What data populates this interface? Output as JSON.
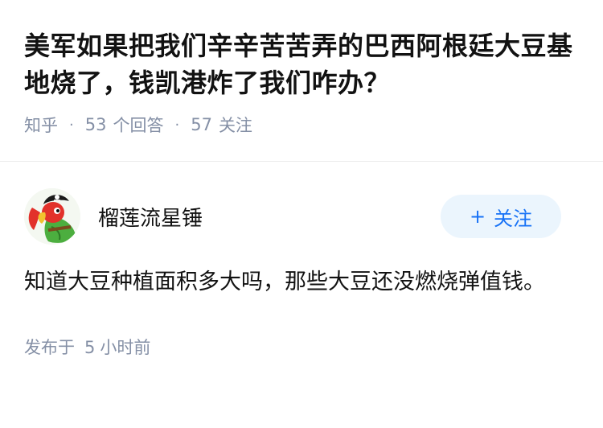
{
  "question": {
    "title": "美军如果把我们辛辛苦苦弄的巴西阿根廷大豆基地烧了，钱凯港炸了我们咋办？",
    "source": "知乎",
    "answer_count": "53",
    "answer_label": "个回答",
    "follower_count": "57",
    "follower_label": "关注"
  },
  "answer": {
    "author_name": "榴莲流星锤",
    "follow_label": "关注",
    "follow_icon": "plus-icon",
    "content": "知道大豆种植面积多大吗，那些大豆还没燃烧弹值钱。",
    "published_prefix": "发布于",
    "published_num": "5",
    "published_suffix": "小时前"
  },
  "colors": {
    "text_primary": "#121212",
    "text_secondary": "#8590a6",
    "accent": "#1772f6",
    "follow_bg": "#ebf5fd"
  }
}
